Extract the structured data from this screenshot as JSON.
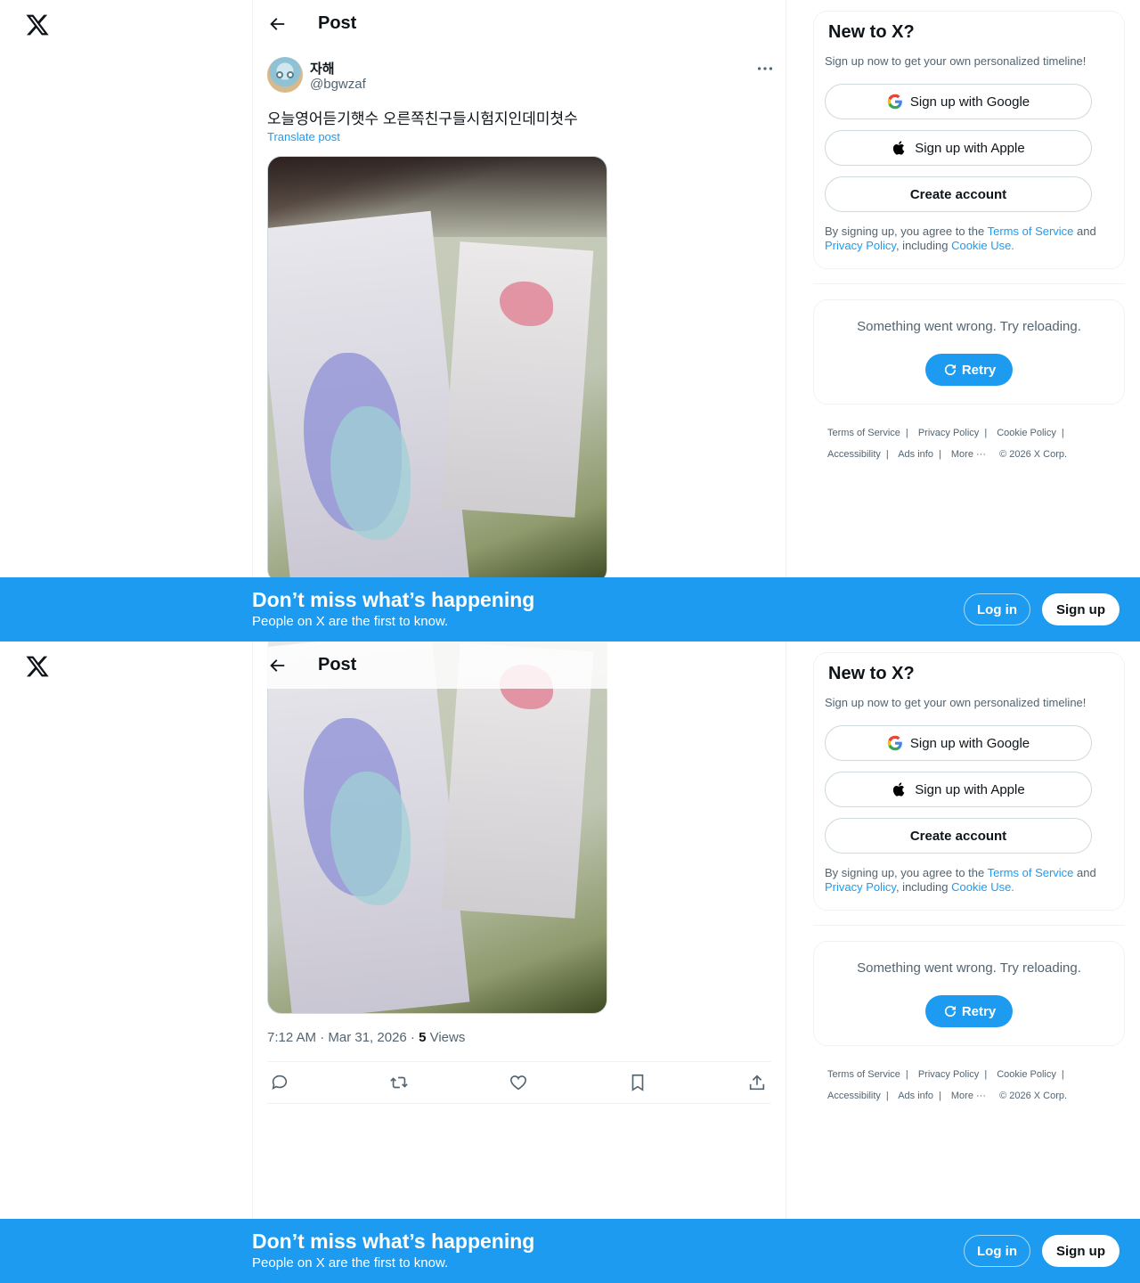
{
  "header": {
    "title": "Post"
  },
  "post": {
    "display_name": "자해",
    "handle": "@bgwzaf",
    "text": "오늘영어듣기햇수 오른쪽친구들시험지인데미쳣수",
    "translate_label": "Translate post",
    "time": "7:12 AM · Mar 31, 2026 · ",
    "views_count": "5",
    "views_label": " Views",
    "image_alt": "Image"
  },
  "signup": {
    "title": "New to X?",
    "subtitle": "Sign up now to get your own personalized timeline!",
    "google": "Sign up with Google",
    "apple": "Sign up with Apple",
    "create": "Create account",
    "legal_pre": "By signing up, you agree to the ",
    "legal_terms": "Terms of Service",
    "legal_and": " and ",
    "legal_privacy": "Privacy Policy",
    "legal_including": ", including ",
    "legal_cookie": "Cookie Use."
  },
  "error": {
    "message": "Something went wrong. Try reloading.",
    "retry": "Retry"
  },
  "footer": {
    "terms": "Terms of Service",
    "privacy": "Privacy Policy",
    "cookie": "Cookie Policy",
    "accessibility": "Accessibility",
    "ads": "Ads info",
    "more": "More ···",
    "copyright": "© 2026 X Corp."
  },
  "banner": {
    "title": "Don’t miss what’s happening",
    "subtitle": "People on X are the first to know.",
    "login": "Log in",
    "signup": "Sign up"
  },
  "colors": {
    "accent": "#1d9bf0",
    "text": "#0f1419",
    "muted": "#536471",
    "border": "#eff3f4"
  }
}
